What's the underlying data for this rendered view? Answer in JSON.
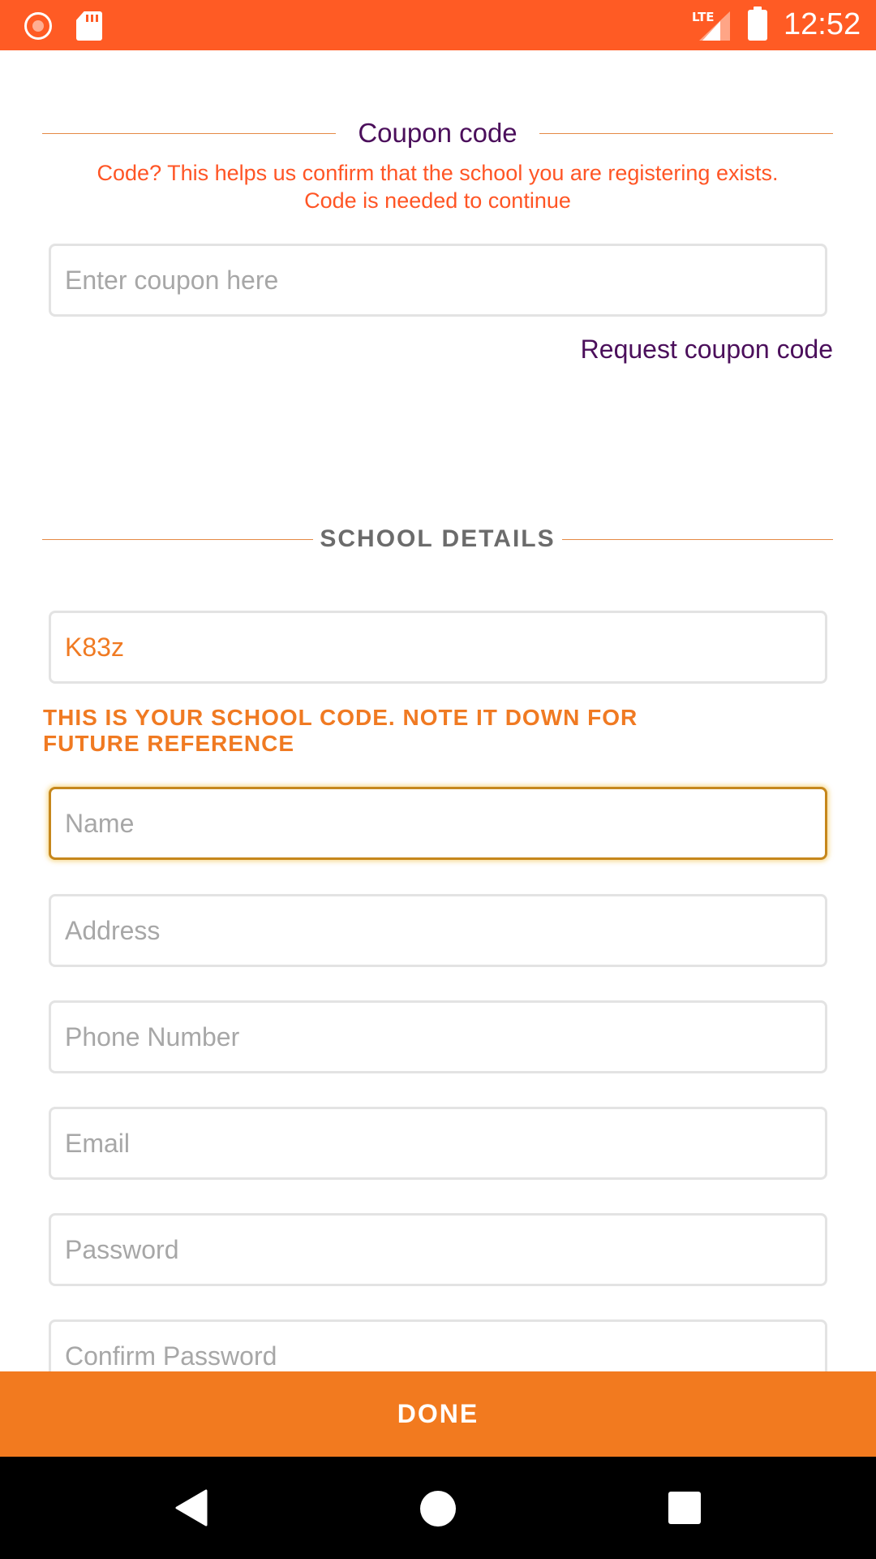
{
  "status_bar": {
    "network": "LTE",
    "time": "12:52",
    "icons": [
      "screen-record-icon",
      "sd-card-icon",
      "signal-icon",
      "battery-icon"
    ]
  },
  "coupon_section": {
    "title": "Coupon code",
    "help_line1": "Code? This helps us confirm that the school you are registering exists.",
    "help_line2": "Code is needed to continue",
    "input_placeholder": "Enter coupon here",
    "request_link": "Request coupon code"
  },
  "school_section": {
    "title": "SCHOOL DETAILS",
    "school_code": "K83z",
    "note_line1": "THIS IS YOUR SCHOOL CODE. NOTE IT DOWN FOR",
    "note_line2": "FUTURE REFERENCE",
    "fields": {
      "name": "Name",
      "address": "Address",
      "phone": "Phone Number",
      "email": "Email",
      "password": "Password",
      "confirm_password": "Confirm Password"
    }
  },
  "actions": {
    "done_label": "DONE"
  },
  "colors": {
    "status_bar": "#ff5b24",
    "accent_orange": "#f27a1f",
    "link_purple": "#4b0f5b",
    "help_text": "#ff5525"
  }
}
